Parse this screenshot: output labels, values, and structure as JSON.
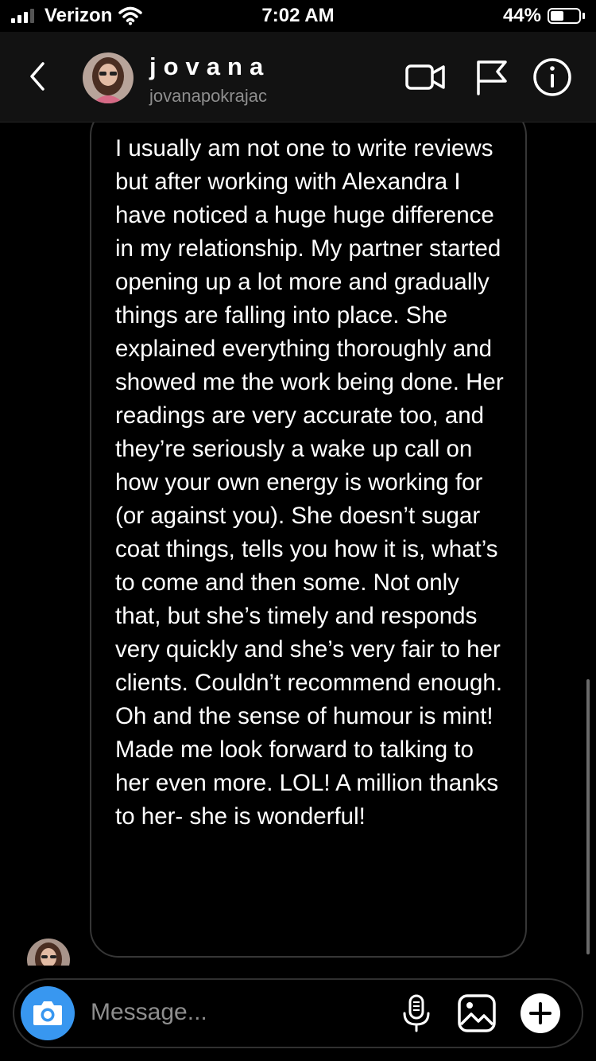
{
  "status_bar": {
    "carrier": "Verizon",
    "time": "7:02 AM",
    "battery_percent": "44%",
    "battery_level": 0.44,
    "signal_bars": 3
  },
  "header": {
    "name": "jovana",
    "username": "jovanapokrajac",
    "icons": [
      "back-chevron-icon",
      "video-call-icon",
      "flag-icon",
      "info-icon"
    ]
  },
  "message": {
    "text": "I usually am not one to write reviews but after working with Alexandra I have noticed a huge huge difference in my relationship. My partner started opening up a lot more and gradually things are falling into place. She explained everything thoroughly and showed me the work being done. Her readings are very accurate too, and they’re seriously a wake up call on how your own energy is working for (or against you). She doesn’t sugar coat things, tells you how it is, what’s to come and then some. Not only that, but she’s timely and responds very quickly and she’s very fair to her clients. Couldn’t recommend enough. Oh and the sense of humour is mint! Made me look forward to talking to her even more. LOL! A million thanks to her- she is wonderful!"
  },
  "composer": {
    "placeholder": "Message...",
    "icons": [
      "camera-icon",
      "microphone-icon",
      "gallery-icon",
      "plus-icon"
    ]
  },
  "colors": {
    "background": "#000000",
    "header_bg": "#121212",
    "bubble_border": "#363636",
    "camera_button": "#3897f0",
    "secondary_text": "#8e8e8e"
  }
}
